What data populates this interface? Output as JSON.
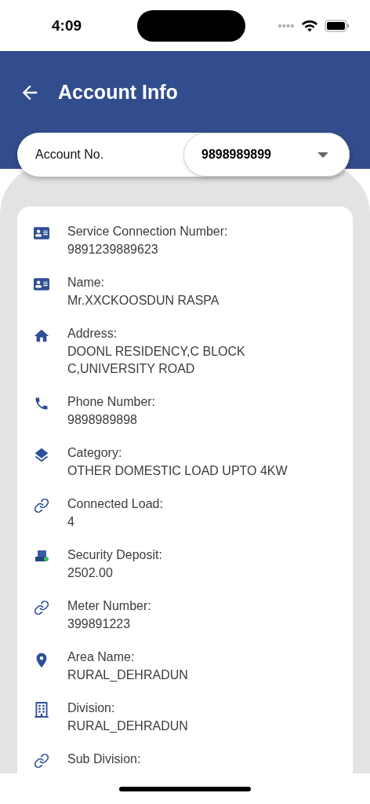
{
  "status_bar": {
    "time": "4:09"
  },
  "header": {
    "title": "Account Info"
  },
  "account_selector": {
    "label": "Account No.",
    "value": "9898989899"
  },
  "details": [
    {
      "kind": "id",
      "label": "Service Connection Number:",
      "value": "9891239889623"
    },
    {
      "kind": "id",
      "label": "Name:",
      "value": "Mr.XXCKOOSDUN RASPA"
    },
    {
      "kind": "home",
      "label": "Address:",
      "value": "DOONL RESIDENCY,C BLOCK C,UNIVERSITY ROAD"
    },
    {
      "kind": "phone",
      "label": "Phone Number:",
      "value": "9898989898"
    },
    {
      "kind": "layers",
      "label": "Category:",
      "value": "OTHER DOMESTIC LOAD UPTO 4KW"
    },
    {
      "kind": "link",
      "label": "Connected Load:",
      "value": "4"
    },
    {
      "kind": "deposit",
      "label": "Security Deposit:",
      "value": "2502.00"
    },
    {
      "kind": "link",
      "label": "Meter Number:",
      "value": "399891223"
    },
    {
      "kind": "pin",
      "label": "Area Name:",
      "value": "RURAL_DEHRADUN"
    },
    {
      "kind": "building",
      "label": "Division:",
      "value": "RURAL_DEHRADUN"
    },
    {
      "kind": "link",
      "label": "Sub Division:"
    }
  ]
}
